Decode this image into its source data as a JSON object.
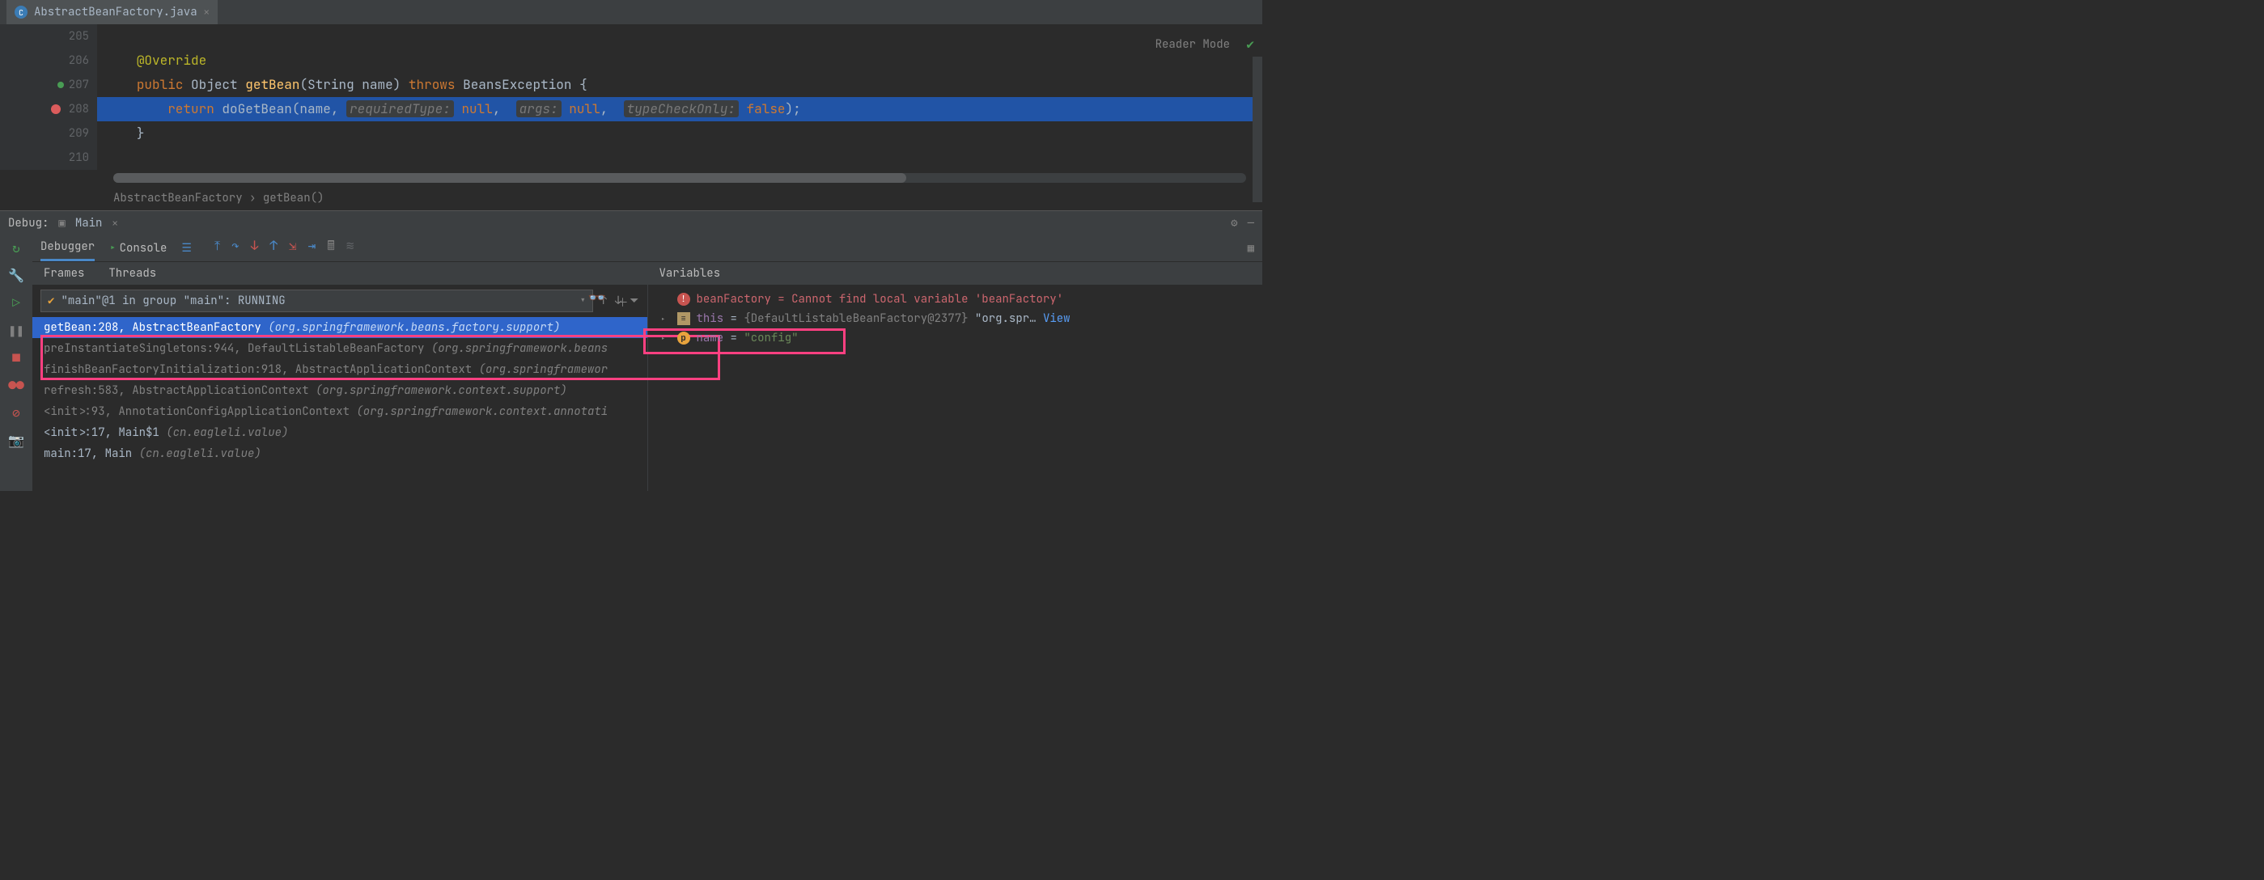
{
  "tab": {
    "filename": "AbstractBeanFactory.java",
    "icon_letter": "C"
  },
  "editor": {
    "reader_mode": "Reader Mode",
    "lines": {
      "l205": "205",
      "l206": "206",
      "l207": "207",
      "l208": "208",
      "l209": "209",
      "l210": "210"
    },
    "code": {
      "override": "@Override",
      "public": "public",
      "object": "Object",
      "getBean": "getBean",
      "sig_open": "(",
      "string": "String",
      "name_param": " name)",
      "throws": "throws",
      "exception": " BeansException {",
      "return": "return",
      "doGetBean": " doGetBean",
      "call_open": "(name, ",
      "hint1": "requiredType:",
      "null1": " null",
      "comma1": ", ",
      "hint2": "args:",
      "null2": " null",
      "comma2": ", ",
      "hint3": "typeCheckOnly:",
      "false": " false",
      "call_close": ");",
      "close_brace": "}"
    }
  },
  "breadcrumb": {
    "class": "AbstractBeanFactory",
    "sep": " › ",
    "method": "getBean()"
  },
  "debug": {
    "label": "Debug:",
    "run_name": "Main",
    "tabs": {
      "debugger": "Debugger",
      "console": "Console"
    },
    "frames_tab": "Frames",
    "threads_tab": "Threads",
    "variables_tab": "Variables",
    "thread_selector": "\"main\"@1 in group \"main\": RUNNING",
    "frames": [
      {
        "method": "getBean:208, AbstractBeanFactory",
        "pkg": "(org.springframework.beans.factory.support)",
        "selected": true,
        "lib": false
      },
      {
        "method": "preInstantiateSingletons:944, DefaultListableBeanFactory",
        "pkg": "(org.springframework.beans",
        "selected": false,
        "lib": true
      },
      {
        "method": "finishBeanFactoryInitialization:918, AbstractApplicationContext",
        "pkg": "(org.springframewor",
        "selected": false,
        "lib": true
      },
      {
        "method": "refresh:583, AbstractApplicationContext",
        "pkg": "(org.springframework.context.support)",
        "selected": false,
        "lib": true
      },
      {
        "method": "<init>:93, AnnotationConfigApplicationContext",
        "pkg": "(org.springframework.context.annotati",
        "selected": false,
        "lib": true
      },
      {
        "method": "<init>:17, Main$1",
        "pkg": "(cn.eagleli.value)",
        "selected": false,
        "lib": false
      },
      {
        "method": "main:17, Main",
        "pkg": "(cn.eagleli.value)",
        "selected": false,
        "lib": false
      }
    ],
    "vars": {
      "v1_name": "beanFactory",
      "v1_val": "Cannot find local variable 'beanFactory'",
      "v2_name": "this",
      "v2_type": "{DefaultListableBeanFactory@2377}",
      "v2_val": "\"org.spr…",
      "v2_view": "View",
      "v3_name": "name",
      "v3_val": "\"config\""
    }
  }
}
